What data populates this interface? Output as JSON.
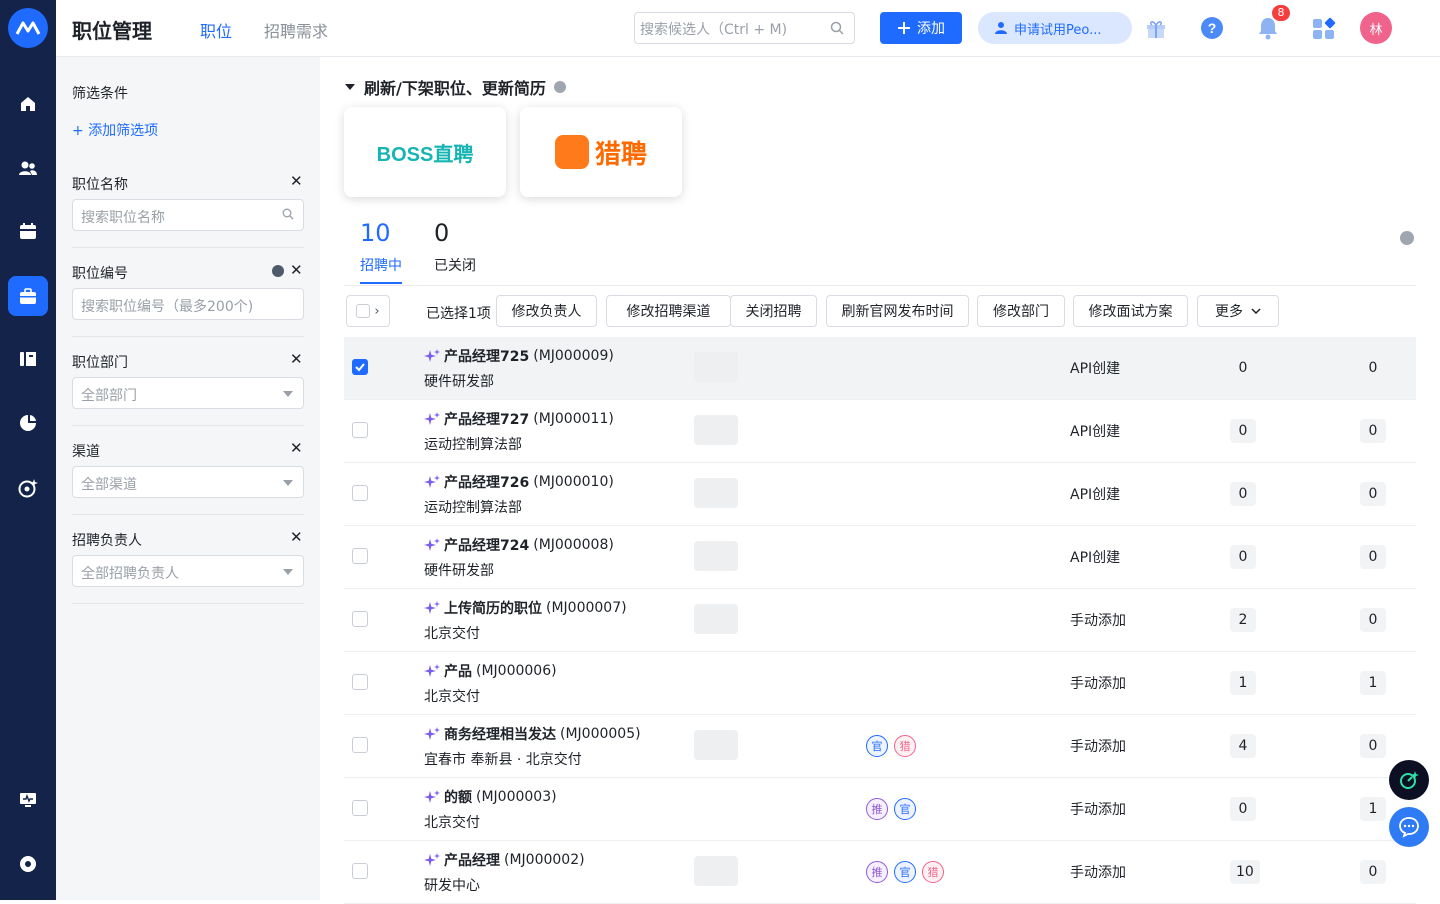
{
  "header": {
    "title": "职位管理",
    "tabs": [
      {
        "label": "职位"
      },
      {
        "label": "招聘需求"
      }
    ],
    "search_placeholder": "搜索候选人（Ctrl + M)",
    "add_label": "添加",
    "trial_label": "申请试用Peo...",
    "notification_count": "8",
    "avatar": "林"
  },
  "filters": {
    "title": "筛选条件",
    "add_label": "添加筛选项",
    "items": [
      {
        "label": "职位名称",
        "placeholder": "搜索职位名称"
      },
      {
        "label": "职位编号",
        "placeholder": "搜索职位编号（最多200个)"
      },
      {
        "label": "职位部门",
        "placeholder": "全部部门"
      },
      {
        "label": "渠道",
        "placeholder": "全部渠道"
      },
      {
        "label": "招聘负责人",
        "placeholder": "全部招聘负责人"
      }
    ]
  },
  "section": {
    "title": "刷新/下架职位、更新简历"
  },
  "channels": [
    {
      "label": "BOSS直聘"
    },
    {
      "label": "猎聘"
    }
  ],
  "stats": [
    {
      "count": "10",
      "label": "招聘中"
    },
    {
      "count": "0",
      "label": "已关闭"
    }
  ],
  "bulk": {
    "selected_text": "已选择1项",
    "actions": [
      "修改负责人",
      "修改招聘渠道",
      "关闭招聘",
      "刷新官网发布时间",
      "修改部门",
      "修改面试方案",
      "更多"
    ]
  },
  "jobs": [
    {
      "name": "产品经理725",
      "code": "(MJ000009)",
      "dept": "硬件研发部",
      "source": "API创建",
      "n1": "0",
      "n2": "0",
      "checked": true,
      "channels": []
    },
    {
      "name": "产品经理727",
      "code": "(MJ000011)",
      "dept": "运动控制算法部",
      "source": "API创建",
      "n1": "0",
      "n2": "0",
      "checked": false,
      "channels": []
    },
    {
      "name": "产品经理726",
      "code": "(MJ000010)",
      "dept": "运动控制算法部",
      "source": "API创建",
      "n1": "0",
      "n2": "0",
      "checked": false,
      "channels": []
    },
    {
      "name": "产品经理724",
      "code": "(MJ000008)",
      "dept": "硬件研发部",
      "source": "API创建",
      "n1": "0",
      "n2": "0",
      "checked": false,
      "channels": []
    },
    {
      "name": "上传简历的职位",
      "code": "(MJ000007)",
      "dept": "北京交付",
      "source": "手动添加",
      "n1": "2",
      "n2": "0",
      "checked": false,
      "channels": []
    },
    {
      "name": "产品",
      "code": "(MJ000006)",
      "dept": "北京交付",
      "source": "手动添加",
      "n1": "1",
      "n2": "1",
      "checked": false,
      "channels": []
    },
    {
      "name": "商务经理相当发达",
      "code": "(MJ000005)",
      "dept": "宜春市 奉新县 · 北京交付",
      "source": "手动添加",
      "n1": "4",
      "n2": "0",
      "checked": false,
      "channels": [
        "官",
        "猎"
      ]
    },
    {
      "name": "的额",
      "code": "(MJ000003)",
      "dept": "北京交付",
      "source": "手动添加",
      "n1": "0",
      "n2": "1",
      "checked": false,
      "channels": [
        "推",
        "官"
      ]
    },
    {
      "name": "产品经理",
      "code": "(MJ000002)",
      "dept": "研发中心",
      "source": "手动添加",
      "n1": "10",
      "n2": "0",
      "checked": false,
      "channels": [
        "推",
        "官",
        "猎"
      ]
    }
  ],
  "colors": {
    "accent": "#1f6bff",
    "sidebar": "#142349",
    "lie": "#f0638c",
    "tui": "#8e5bd8"
  }
}
